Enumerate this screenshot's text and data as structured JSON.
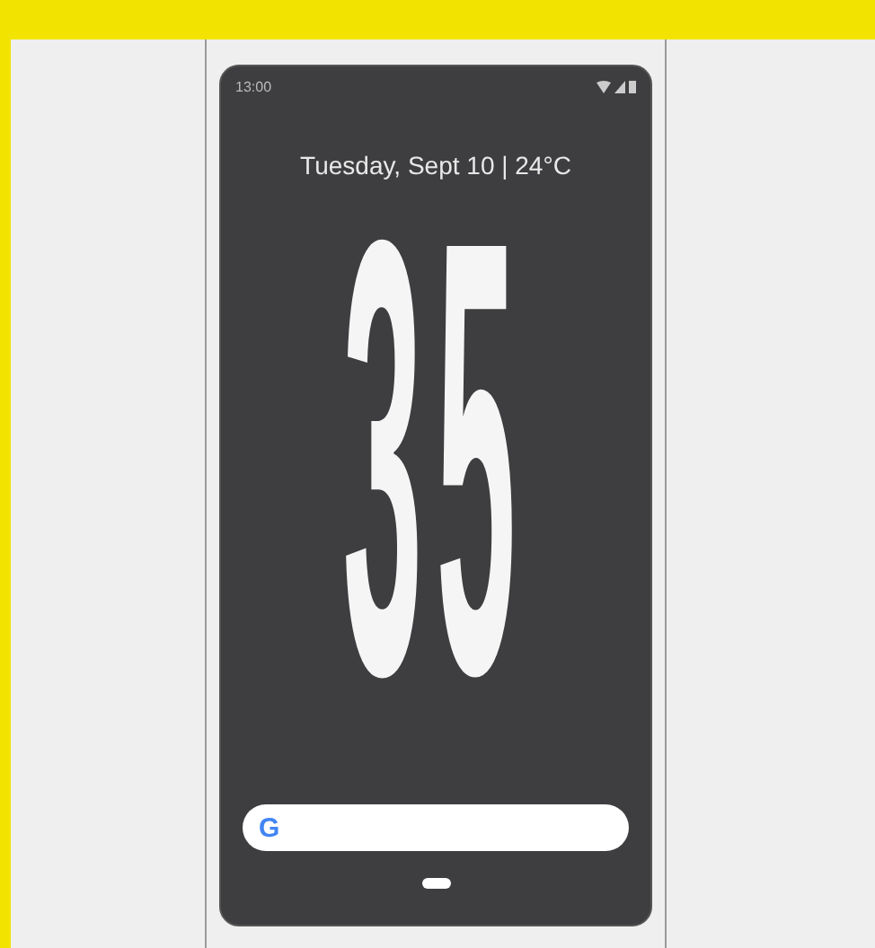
{
  "status_bar": {
    "time": "13:00"
  },
  "lock_screen": {
    "date_weather": "Tuesday, Sept 10 | 24°C",
    "clock": "35"
  },
  "search_bar": {
    "logo": "G"
  }
}
